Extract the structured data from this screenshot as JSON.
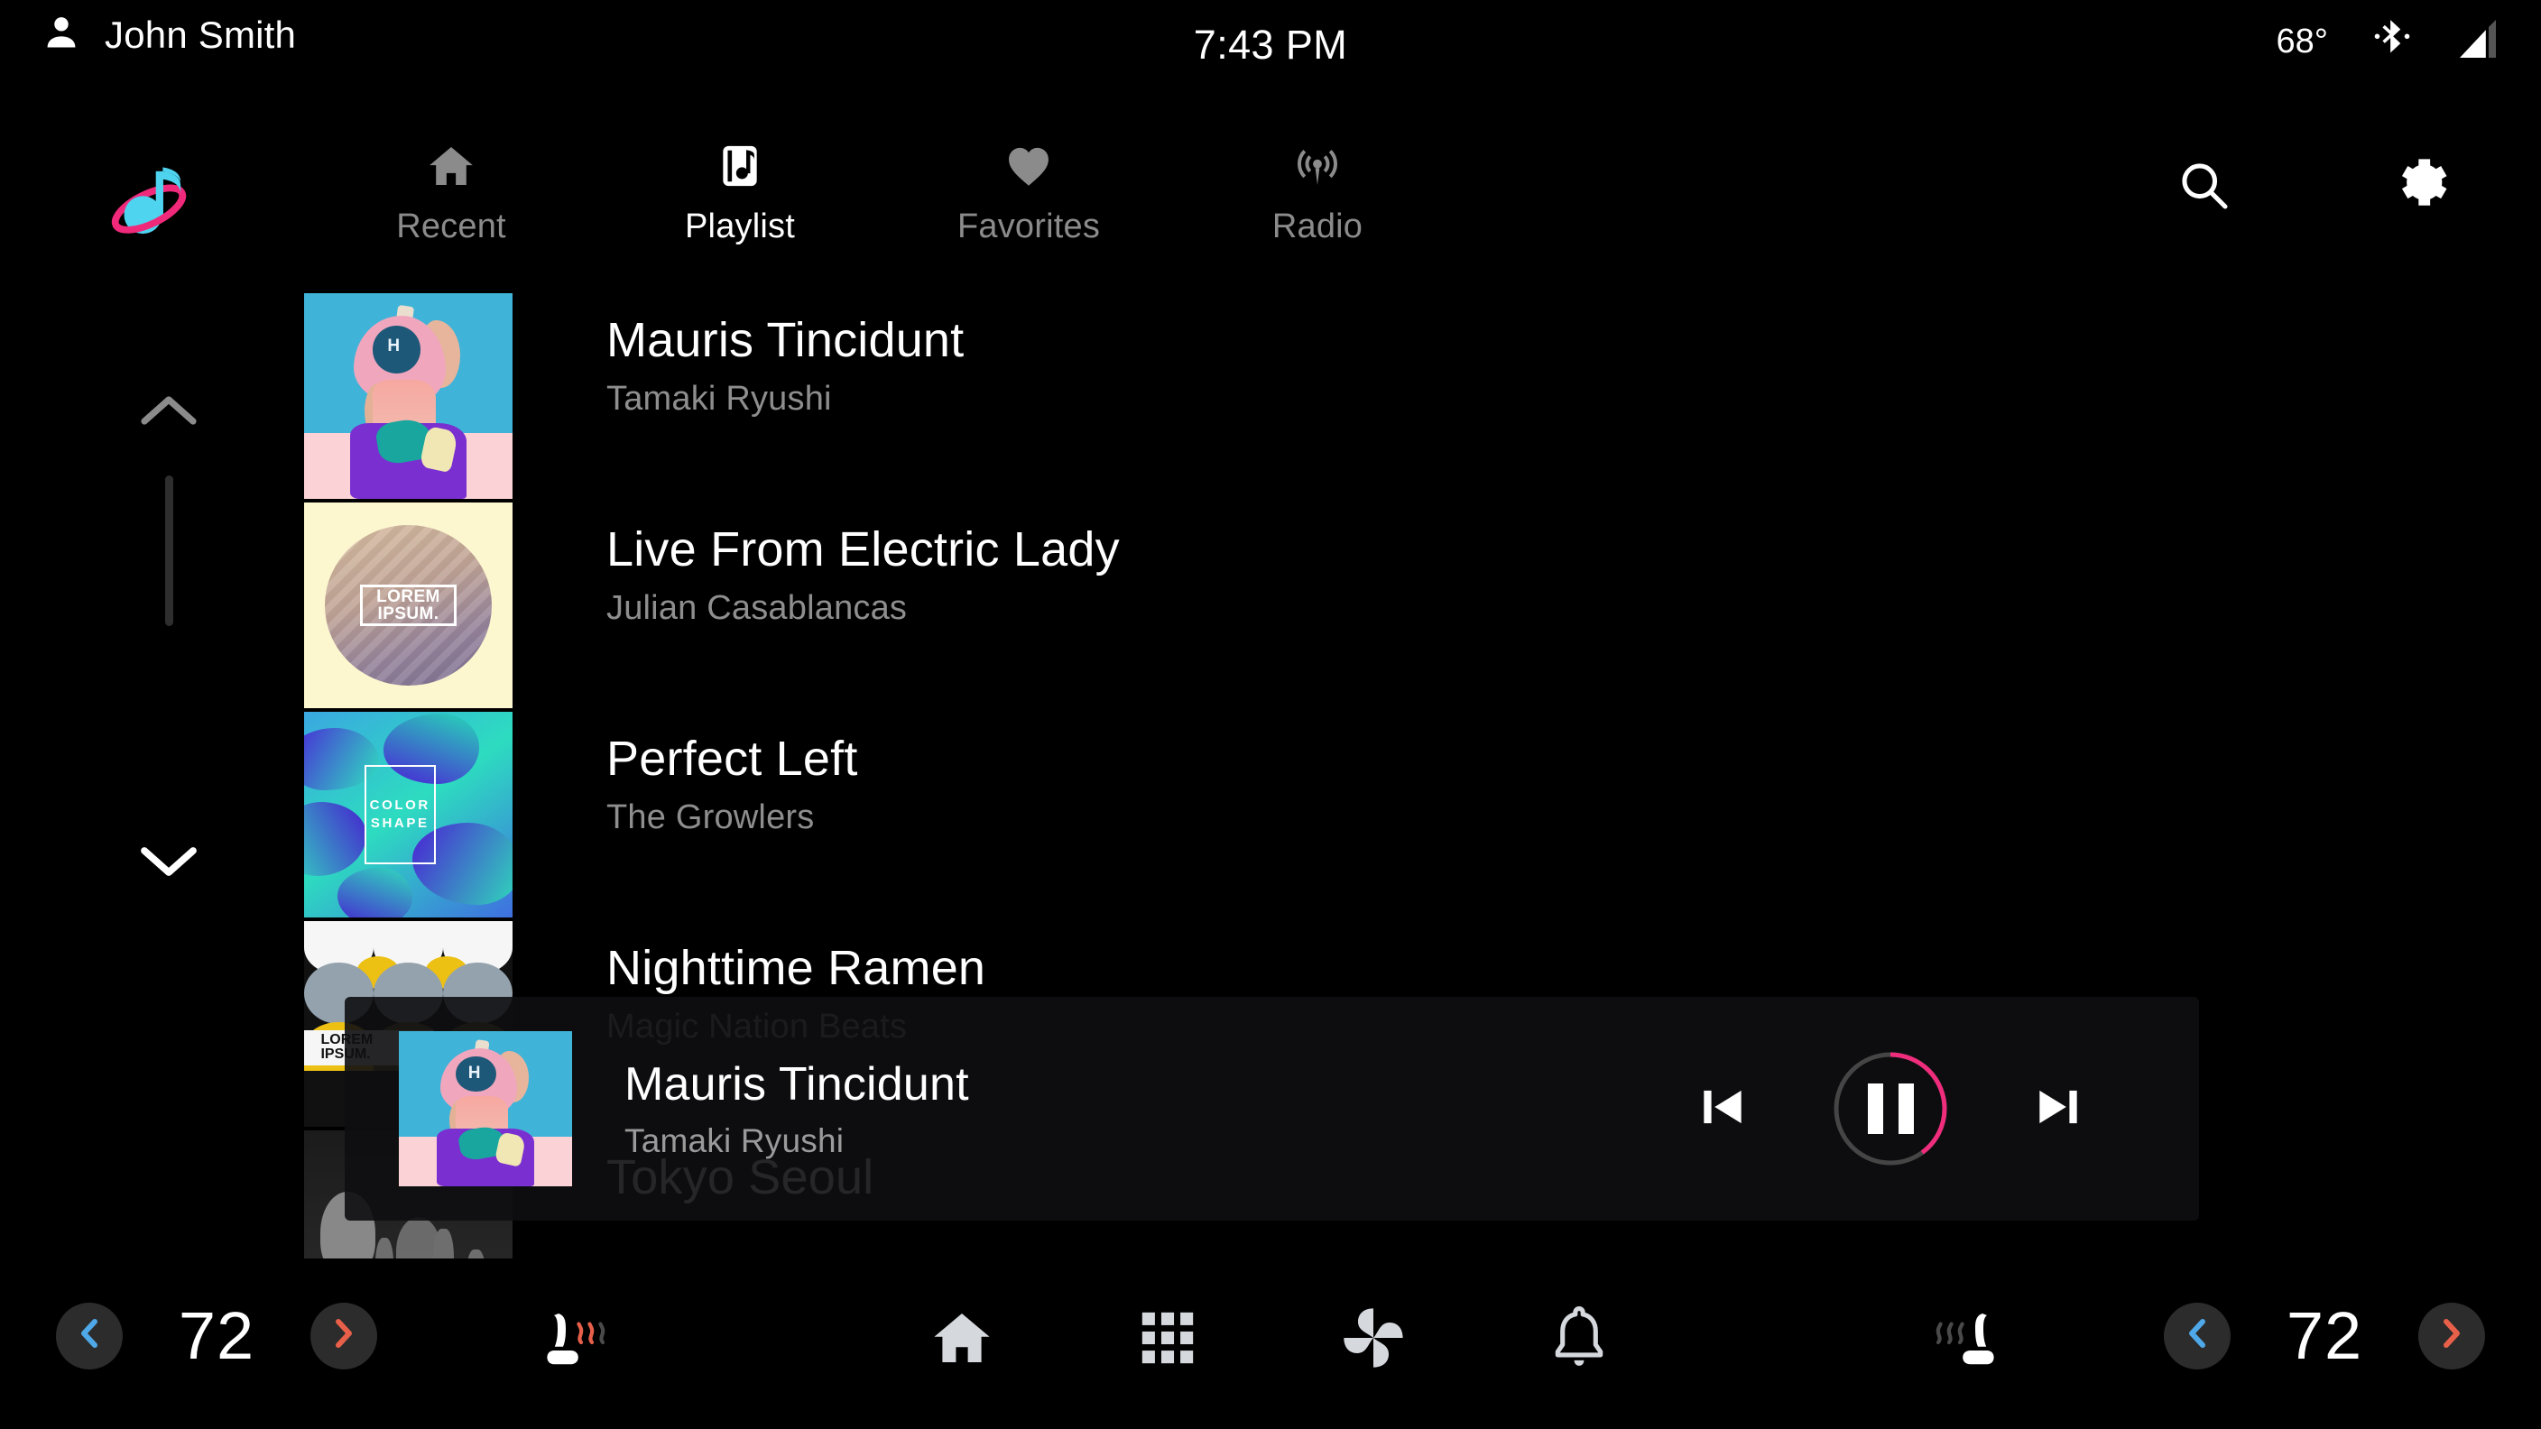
{
  "status_bar": {
    "user_name": "John Smith",
    "user_icon": "person-icon",
    "clock": "7:43 PM",
    "temperature": "68°",
    "bluetooth_icon": "bluetooth-icon",
    "signal_icon": "cellular-signal-icon"
  },
  "app": {
    "logo_icon": "music-planet-logo-icon",
    "logo_colors": {
      "note": "#4FD4F0",
      "orbit": "#F0297A"
    }
  },
  "tabs": [
    {
      "label": "Recent",
      "icon": "home-icon",
      "active": false
    },
    {
      "label": "Playlist",
      "icon": "music-library-icon",
      "active": true
    },
    {
      "label": "Favorites",
      "icon": "heart-icon",
      "active": false
    },
    {
      "label": "Radio",
      "icon": "radio-waves-icon",
      "active": false
    }
  ],
  "nav_actions": [
    {
      "label": "Search",
      "icon": "search-icon"
    },
    {
      "label": "Settings",
      "icon": "gear-icon"
    }
  ],
  "scrollbar": {
    "up_icon": "chevron-up-icon",
    "down_icon": "chevron-down-icon"
  },
  "tracks": [
    {
      "title": "Mauris Tincidunt",
      "artist": "Tamaki Ryushi",
      "art": "pink-headphones-portrait"
    },
    {
      "title": "Live From Electric Lady",
      "artist": "Julian Casablancas",
      "art": "lorem-ipsum-sphere",
      "art_text": "LOREM\nIPSUM."
    },
    {
      "title": "Perfect Left",
      "artist": "The Growlers",
      "art": "color-shape-gradient",
      "art_text": "COLOR\nSHAPE"
    },
    {
      "title": "Nighttime Ramen",
      "artist": "Magic Nation Beats",
      "art": "arch-shapes-lorem",
      "art_text": "LOREM\nIPSUM."
    },
    {
      "title": "Tokyo Seoul",
      "artist": "",
      "art": "crowd-photo-grayscale"
    }
  ],
  "now_playing": {
    "title": "Mauris Tincidunt",
    "artist": "Tamaki Ryushi",
    "art": "pink-headphones-portrait",
    "progress_percent": 40,
    "progress_color": "#F02D7D",
    "track_ring_color": "#454545",
    "controls": [
      {
        "name": "previous-track-button",
        "icon": "skip-previous-icon"
      },
      {
        "name": "play-pause-button",
        "icon": "pause-icon"
      },
      {
        "name": "next-track-button",
        "icon": "skip-next-icon"
      }
    ]
  },
  "bottom_bar": {
    "left_climate": {
      "value": "72",
      "decrease_icon": "chevron-left-icon",
      "increase_icon": "chevron-right-icon"
    },
    "right_climate": {
      "value": "72",
      "decrease_icon": "chevron-left-icon",
      "increase_icon": "chevron-right-icon"
    },
    "left_seat": {
      "icon": "heated-seat-icon",
      "active": true
    },
    "right_seat": {
      "icon": "heated-seat-icon",
      "active": false
    },
    "system_icons": [
      {
        "label": "Home",
        "icon": "home-icon"
      },
      {
        "label": "Apps",
        "icon": "apps-grid-icon"
      },
      {
        "label": "Climate",
        "icon": "fan-icon"
      },
      {
        "label": "Notifications",
        "icon": "bell-icon"
      }
    ],
    "cool_color": "#4FA8E8",
    "heat_color": "#E8604A"
  }
}
